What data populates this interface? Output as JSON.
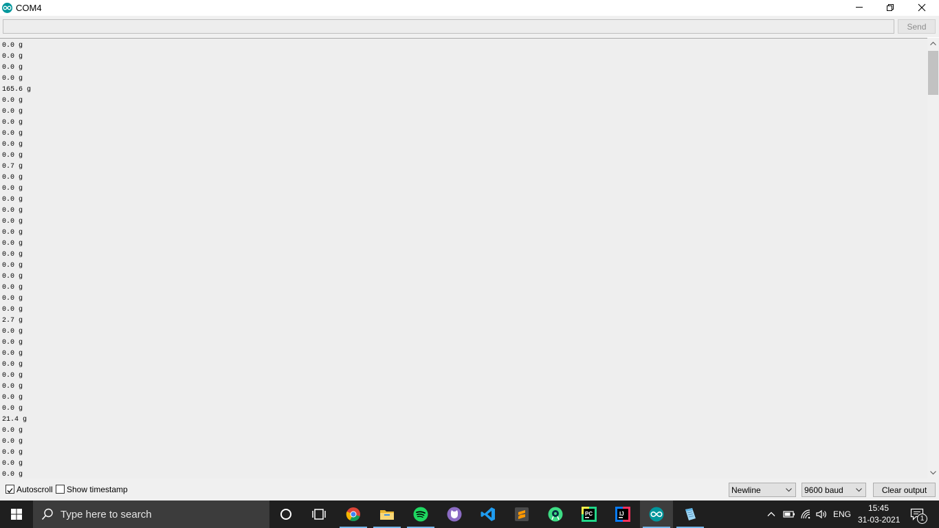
{
  "window": {
    "title": "COM4"
  },
  "send_bar": {
    "input_value": "",
    "send_label": "Send"
  },
  "serial_output": [
    "0.0 g",
    "0.0 g",
    "0.0 g",
    "0.0 g",
    "165.6 g",
    "0.0 g",
    "0.0 g",
    "0.0 g",
    "0.0 g",
    "0.0 g",
    "0.0 g",
    "0.7 g",
    "0.0 g",
    "0.0 g",
    "0.0 g",
    "0.0 g",
    "0.0 g",
    "0.0 g",
    "0.0 g",
    "0.0 g",
    "0.0 g",
    "0.0 g",
    "0.0 g",
    "0.0 g",
    "0.0 g",
    "2.7 g",
    "0.0 g",
    "0.0 g",
    "0.0 g",
    "0.0 g",
    "0.0 g",
    "0.0 g",
    "0.0 g",
    "0.0 g",
    "21.4 g",
    "0.0 g",
    "0.0 g",
    "0.0 g",
    "0.0 g",
    "0.0 g"
  ],
  "bottom_bar": {
    "autoscroll_label": "Autoscroll",
    "autoscroll_checked": true,
    "timestamp_label": "Show timestamp",
    "timestamp_checked": false,
    "line_ending": "Newline",
    "baud_rate": "9600 baud",
    "clear_label": "Clear output"
  },
  "taskbar": {
    "search_placeholder": "Type here to search",
    "apps": [
      "cortana-icon",
      "task-view-icon",
      "chrome-icon",
      "file-explorer-icon",
      "spotify-icon",
      "github-desktop-icon",
      "vscode-icon",
      "sublime-text-icon",
      "android-studio-icon",
      "pycharm-icon",
      "intellij-icon",
      "arduino-icon",
      "notepad-icon"
    ],
    "language": "ENG",
    "time": "15:45",
    "date": "31-03-2021",
    "notification_count": "1"
  },
  "colors": {
    "arduino_teal": "#00979c",
    "output_bg": "#eeeeee",
    "taskbar_bg": "#1f1f1f",
    "active_underline": "#76b9ed"
  }
}
